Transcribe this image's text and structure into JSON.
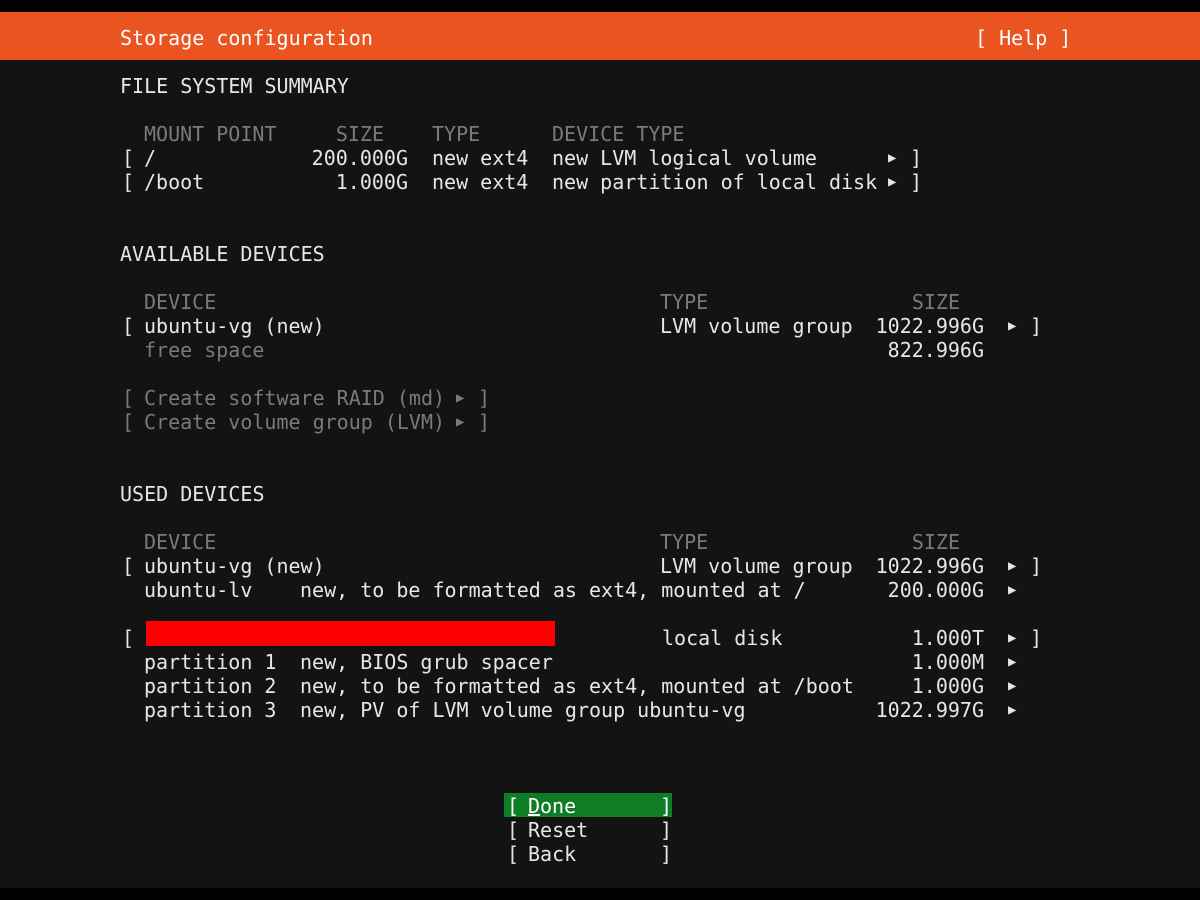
{
  "header": {
    "title": "Storage configuration",
    "help": "[ Help ]"
  },
  "fs_summary": {
    "heading": "FILE SYSTEM SUMMARY",
    "columns": [
      "MOUNT POINT",
      "SIZE",
      "TYPE",
      "DEVICE TYPE"
    ],
    "rows": [
      {
        "open": "[",
        "mount": "/",
        "size": "200.000G",
        "type": "new ext4",
        "device_type": "new LVM logical volume",
        "arrow": "▶",
        "close": "]"
      },
      {
        "open": "[",
        "mount": "/boot",
        "size": "1.000G",
        "type": "new ext4",
        "device_type": "new partition of local disk",
        "arrow": "▶",
        "close": "]"
      }
    ]
  },
  "available": {
    "heading": "AVAILABLE DEVICES",
    "columns": [
      "DEVICE",
      "TYPE",
      "SIZE"
    ],
    "device": {
      "open": "[",
      "name": "ubuntu-vg (new)",
      "type": "LVM volume group",
      "size": "1022.996G",
      "arrow": "▶",
      "close": "]"
    },
    "free": {
      "label": "free space",
      "size": "822.996G"
    },
    "actions": [
      {
        "open": "[",
        "label": "Create software RAID (md)",
        "arrow": "▶",
        "close": "]"
      },
      {
        "open": "[",
        "label": "Create volume group (LVM)",
        "arrow": "▶",
        "close": "]"
      }
    ]
  },
  "used": {
    "heading": "USED DEVICES",
    "columns": [
      "DEVICE",
      "TYPE",
      "SIZE"
    ],
    "vg": {
      "open": "[",
      "name": "ubuntu-vg (new)",
      "type": "LVM volume group",
      "size": "1022.996G",
      "arrow": "▶",
      "close": "]"
    },
    "lv": {
      "name": "ubuntu-lv",
      "desc": "new, to be formatted as ext4, mounted at /",
      "size": "200.000G",
      "arrow": "▶"
    },
    "disk": {
      "open": "[",
      "type": "local disk",
      "size": "1.000T",
      "arrow": "▶",
      "close": "]"
    },
    "partitions": [
      {
        "name": "partition 1",
        "desc": "new, BIOS grub spacer",
        "size": "1.000M",
        "arrow": "▶"
      },
      {
        "name": "partition 2",
        "desc": "new, to be formatted as ext4, mounted at /boot",
        "size": "1.000G",
        "arrow": "▶"
      },
      {
        "name": "partition 3",
        "desc": "new, PV of LVM volume group ubuntu-vg",
        "size": "1022.997G",
        "arrow": "▶"
      }
    ]
  },
  "buttons": {
    "done": {
      "open": "[",
      "first": "D",
      "rest": "one",
      "close": "]"
    },
    "reset": {
      "open": "[",
      "label": "Reset",
      "close": "]"
    },
    "back": {
      "open": "[",
      "label": "Back",
      "close": "]"
    }
  },
  "colors": {
    "accent": "#e95420",
    "selected": "#0e7d25",
    "background": "#131313",
    "dim_text": "#7a7a7a"
  }
}
